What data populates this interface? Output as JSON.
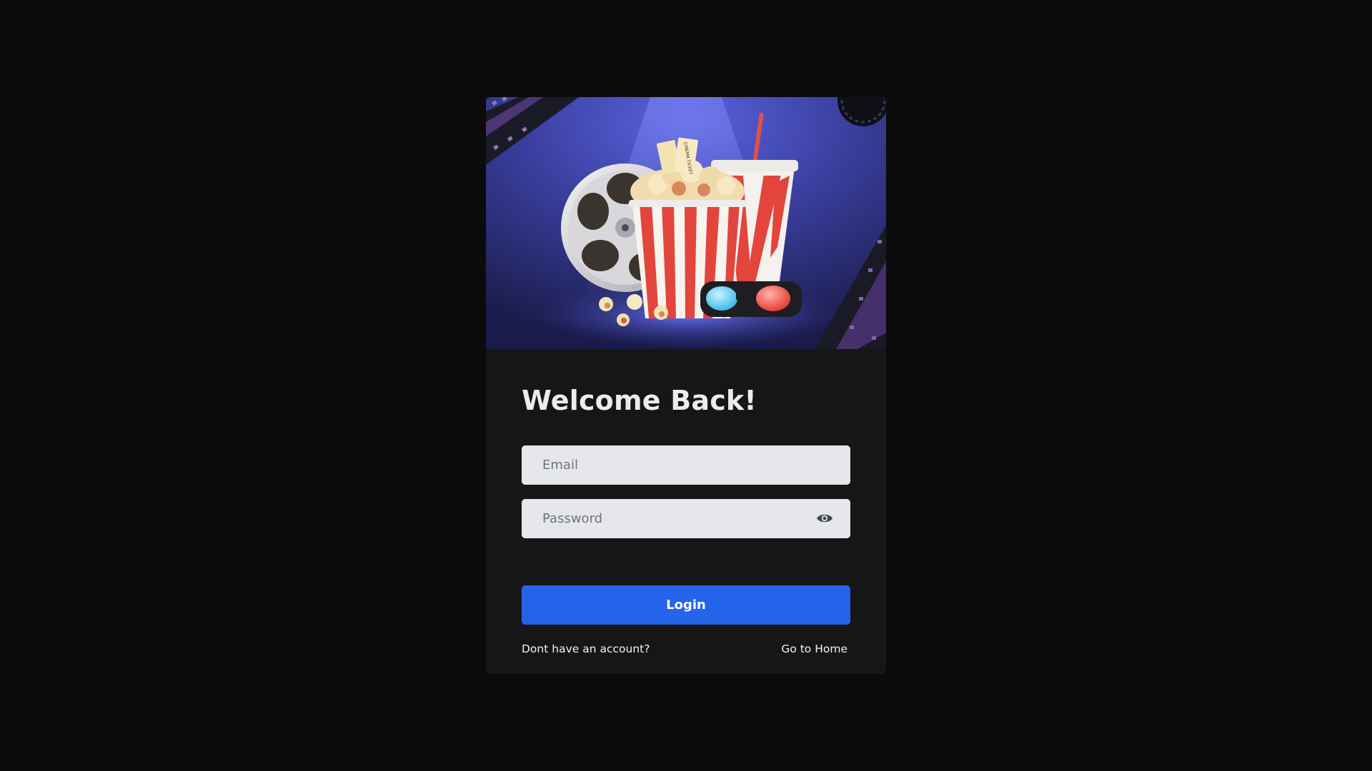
{
  "hero": {
    "image": "cinema-popcorn-illustration",
    "ticket_text": "CINEMA TICKET",
    "colors": {
      "background": "#3b3fa8",
      "popcorn_stripe_red": "#e2453c",
      "glasses_left": "#6fd3f5",
      "glasses_right": "#f2574f"
    }
  },
  "form": {
    "title": "Welcome Back!",
    "email": {
      "placeholder": "Email",
      "value": ""
    },
    "password": {
      "placeholder": "Password",
      "value": "",
      "toggle_icon": "eye-icon"
    },
    "login_label": "Login",
    "signup_link": "Dont have an account?",
    "home_link": "Go to Home"
  },
  "theme": {
    "page_bg": "#0b0b0b",
    "card_bg": "#161617",
    "input_bg": "#e6e7ea",
    "accent": "#2563eb",
    "text": "#ececec"
  }
}
